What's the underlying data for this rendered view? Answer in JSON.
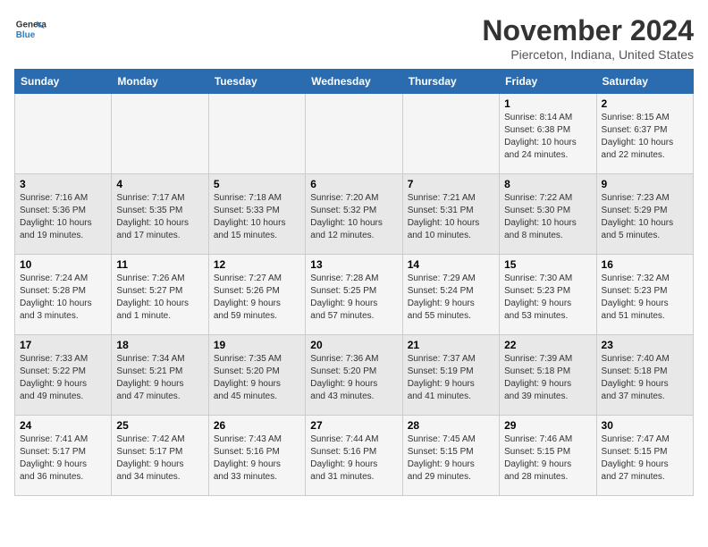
{
  "logo": {
    "line1": "General",
    "line2": "Blue"
  },
  "title": "November 2024",
  "location": "Pierceton, Indiana, United States",
  "weekdays": [
    "Sunday",
    "Monday",
    "Tuesday",
    "Wednesday",
    "Thursday",
    "Friday",
    "Saturday"
  ],
  "weeks": [
    [
      {
        "day": "",
        "details": ""
      },
      {
        "day": "",
        "details": ""
      },
      {
        "day": "",
        "details": ""
      },
      {
        "day": "",
        "details": ""
      },
      {
        "day": "",
        "details": ""
      },
      {
        "day": "1",
        "details": "Sunrise: 8:14 AM\nSunset: 6:38 PM\nDaylight: 10 hours\nand 24 minutes."
      },
      {
        "day": "2",
        "details": "Sunrise: 8:15 AM\nSunset: 6:37 PM\nDaylight: 10 hours\nand 22 minutes."
      }
    ],
    [
      {
        "day": "3",
        "details": "Sunrise: 7:16 AM\nSunset: 5:36 PM\nDaylight: 10 hours\nand 19 minutes."
      },
      {
        "day": "4",
        "details": "Sunrise: 7:17 AM\nSunset: 5:35 PM\nDaylight: 10 hours\nand 17 minutes."
      },
      {
        "day": "5",
        "details": "Sunrise: 7:18 AM\nSunset: 5:33 PM\nDaylight: 10 hours\nand 15 minutes."
      },
      {
        "day": "6",
        "details": "Sunrise: 7:20 AM\nSunset: 5:32 PM\nDaylight: 10 hours\nand 12 minutes."
      },
      {
        "day": "7",
        "details": "Sunrise: 7:21 AM\nSunset: 5:31 PM\nDaylight: 10 hours\nand 10 minutes."
      },
      {
        "day": "8",
        "details": "Sunrise: 7:22 AM\nSunset: 5:30 PM\nDaylight: 10 hours\nand 8 minutes."
      },
      {
        "day": "9",
        "details": "Sunrise: 7:23 AM\nSunset: 5:29 PM\nDaylight: 10 hours\nand 5 minutes."
      }
    ],
    [
      {
        "day": "10",
        "details": "Sunrise: 7:24 AM\nSunset: 5:28 PM\nDaylight: 10 hours\nand 3 minutes."
      },
      {
        "day": "11",
        "details": "Sunrise: 7:26 AM\nSunset: 5:27 PM\nDaylight: 10 hours\nand 1 minute."
      },
      {
        "day": "12",
        "details": "Sunrise: 7:27 AM\nSunset: 5:26 PM\nDaylight: 9 hours\nand 59 minutes."
      },
      {
        "day": "13",
        "details": "Sunrise: 7:28 AM\nSunset: 5:25 PM\nDaylight: 9 hours\nand 57 minutes."
      },
      {
        "day": "14",
        "details": "Sunrise: 7:29 AM\nSunset: 5:24 PM\nDaylight: 9 hours\nand 55 minutes."
      },
      {
        "day": "15",
        "details": "Sunrise: 7:30 AM\nSunset: 5:23 PM\nDaylight: 9 hours\nand 53 minutes."
      },
      {
        "day": "16",
        "details": "Sunrise: 7:32 AM\nSunset: 5:23 PM\nDaylight: 9 hours\nand 51 minutes."
      }
    ],
    [
      {
        "day": "17",
        "details": "Sunrise: 7:33 AM\nSunset: 5:22 PM\nDaylight: 9 hours\nand 49 minutes."
      },
      {
        "day": "18",
        "details": "Sunrise: 7:34 AM\nSunset: 5:21 PM\nDaylight: 9 hours\nand 47 minutes."
      },
      {
        "day": "19",
        "details": "Sunrise: 7:35 AM\nSunset: 5:20 PM\nDaylight: 9 hours\nand 45 minutes."
      },
      {
        "day": "20",
        "details": "Sunrise: 7:36 AM\nSunset: 5:20 PM\nDaylight: 9 hours\nand 43 minutes."
      },
      {
        "day": "21",
        "details": "Sunrise: 7:37 AM\nSunset: 5:19 PM\nDaylight: 9 hours\nand 41 minutes."
      },
      {
        "day": "22",
        "details": "Sunrise: 7:39 AM\nSunset: 5:18 PM\nDaylight: 9 hours\nand 39 minutes."
      },
      {
        "day": "23",
        "details": "Sunrise: 7:40 AM\nSunset: 5:18 PM\nDaylight: 9 hours\nand 37 minutes."
      }
    ],
    [
      {
        "day": "24",
        "details": "Sunrise: 7:41 AM\nSunset: 5:17 PM\nDaylight: 9 hours\nand 36 minutes."
      },
      {
        "day": "25",
        "details": "Sunrise: 7:42 AM\nSunset: 5:17 PM\nDaylight: 9 hours\nand 34 minutes."
      },
      {
        "day": "26",
        "details": "Sunrise: 7:43 AM\nSunset: 5:16 PM\nDaylight: 9 hours\nand 33 minutes."
      },
      {
        "day": "27",
        "details": "Sunrise: 7:44 AM\nSunset: 5:16 PM\nDaylight: 9 hours\nand 31 minutes."
      },
      {
        "day": "28",
        "details": "Sunrise: 7:45 AM\nSunset: 5:15 PM\nDaylight: 9 hours\nand 29 minutes."
      },
      {
        "day": "29",
        "details": "Sunrise: 7:46 AM\nSunset: 5:15 PM\nDaylight: 9 hours\nand 28 minutes."
      },
      {
        "day": "30",
        "details": "Sunrise: 7:47 AM\nSunset: 5:15 PM\nDaylight: 9 hours\nand 27 minutes."
      }
    ]
  ]
}
